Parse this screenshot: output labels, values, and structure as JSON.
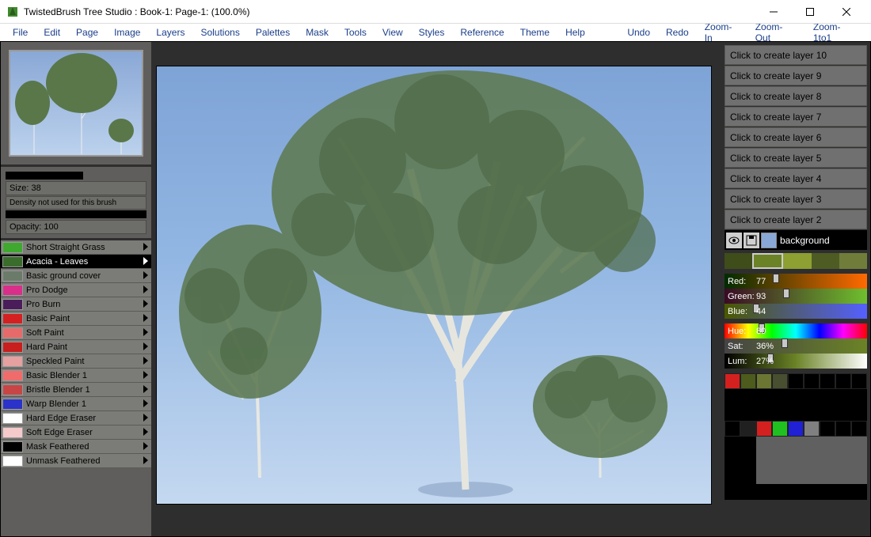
{
  "title": "TwistedBrush Tree Studio : Book-1: Page-1:  (100.0%)",
  "menubar": [
    "File",
    "Edit",
    "Page",
    "Image",
    "Layers",
    "Solutions",
    "Palettes",
    "Mask",
    "Tools",
    "View",
    "Styles",
    "Reference",
    "Theme",
    "Help"
  ],
  "menubar2": [
    "Undo",
    "Redo",
    "Zoom-In",
    "Zoom-Out",
    "Zoom-1to1"
  ],
  "brushProps": {
    "sizeLabel": "Size: 38",
    "densityLabel": "Density not used for this brush",
    "opacityLabel": "Opacity: 100"
  },
  "brushes": [
    {
      "name": "Short Straight Grass",
      "swatch": "#3fa82e",
      "selected": false
    },
    {
      "name": "Acacia - Leaves",
      "swatch": "#3a6d2c",
      "selected": true
    },
    {
      "name": "Basic ground cover",
      "swatch": "#6b7b6a",
      "selected": false
    },
    {
      "name": "Pro Dodge",
      "swatch": "#d92f8a",
      "selected": false
    },
    {
      "name": "Pro Burn",
      "swatch": "#4a1d5a",
      "selected": false
    },
    {
      "name": "Basic Paint",
      "swatch": "#d42020",
      "selected": false
    },
    {
      "name": "Soft Paint",
      "swatch": "#e66a6a",
      "selected": false
    },
    {
      "name": "Hard Paint",
      "swatch": "#c81e1e",
      "selected": false
    },
    {
      "name": "Speckled Paint",
      "swatch": "#e5a0a0",
      "selected": false
    },
    {
      "name": "Basic Blender 1",
      "swatch": "#f06b6b",
      "selected": false
    },
    {
      "name": "Bristle Blender 1",
      "swatch": "#c74545",
      "selected": false
    },
    {
      "name": "Warp Blender 1",
      "swatch": "#2a32c9",
      "selected": false
    },
    {
      "name": "Hard Edge Eraser",
      "swatch": "#ffffff",
      "selected": false
    },
    {
      "name": "Soft Edge Eraser",
      "swatch": "#f5caca",
      "selected": false
    },
    {
      "name": "Mask Feathered",
      "swatch": "#000000",
      "selected": false
    },
    {
      "name": "Unmask Feathered",
      "swatch": "#ffffff",
      "selected": false
    }
  ],
  "layers": {
    "emptySlots": [
      "Click to create layer 10",
      "Click to create layer 9",
      "Click to create layer 8",
      "Click to create layer 7",
      "Click to create layer 6",
      "Click to create layer 5",
      "Click to create layer 4",
      "Click to create layer 3",
      "Click to create layer 2"
    ],
    "activeLabel": "background"
  },
  "greens": [
    "#3f4d1a",
    "#6b8326",
    "#8ea031",
    "#4e5c24",
    "#707d3a"
  ],
  "rgb": {
    "red": {
      "label": "Red:",
      "value": "77",
      "grad": "linear-gradient(90deg,#002b00,#ff6a00)",
      "pos": 34
    },
    "green": {
      "label": "Green:",
      "value": "93",
      "grad": "linear-gradient(90deg,#3a0a25,#6fbf2e)",
      "pos": 41
    },
    "blue": {
      "label": "Blue:",
      "value": "44",
      "grad": "linear-gradient(90deg,#4a5800,#5560ff)",
      "pos": 20
    }
  },
  "hsl": {
    "hue": {
      "label": "Hue:",
      "value": "80",
      "grad": "linear-gradient(90deg,#f00,#ff0,#0f0,#0ff,#00f,#f0f,#f00)",
      "pos": 24
    },
    "sat": {
      "label": "Sat:",
      "value": "36%",
      "grad": "linear-gradient(90deg,#444,#6b8326)",
      "pos": 40
    },
    "lum": {
      "label": "Lum:",
      "value": "27%",
      "grad": "linear-gradient(90deg,#000,#6b8326,#fff)",
      "pos": 30
    }
  },
  "palette": {
    "row0": [
      "#d52020",
      "#4d5b1d",
      "#6a7632",
      "#474f30",
      "#000000",
      "#000000",
      "#000000",
      "#000000",
      "#000000"
    ],
    "row3": [
      "#000000",
      "#202020",
      "#d52020",
      "#20c020",
      "#2020d5",
      "#808080",
      "#000000",
      "#000000",
      "#000000"
    ]
  }
}
